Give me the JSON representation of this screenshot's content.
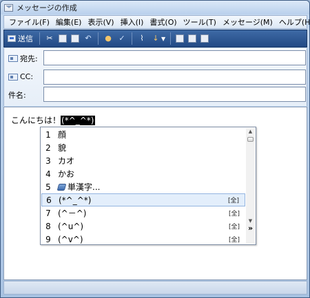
{
  "window": {
    "title": "メッセージの作成"
  },
  "menubar": {
    "items": [
      "ファイル(F)",
      "編集(E)",
      "表示(V)",
      "挿入(I)",
      "書式(O)",
      "ツール(T)",
      "メッセージ(M)",
      "ヘルプ(H)"
    ]
  },
  "toolbar": {
    "send_label": "送信",
    "icons": [
      "cut-icon",
      "copy-icon",
      "paste-icon",
      "undo-icon",
      "check-names-icon",
      "spelling-icon",
      "attach-icon",
      "priority-icon",
      "sign-icon",
      "encrypt-icon",
      "work-offline-icon"
    ]
  },
  "fields": {
    "to_label": "宛先:",
    "to_value": "",
    "cc_label": "CC:",
    "cc_value": "",
    "subject_label": "件名:",
    "subject_value": ""
  },
  "body": {
    "text": "こんにちは！",
    "selected_text": "(*^_^*)"
  },
  "ime": {
    "selected_index": 6,
    "candidates": [
      {
        "num": "1",
        "text": "顔",
        "tag": ""
      },
      {
        "num": "2",
        "text": "貌",
        "tag": ""
      },
      {
        "num": "3",
        "text": "カオ",
        "tag": ""
      },
      {
        "num": "4",
        "text": "かお",
        "tag": ""
      },
      {
        "num": "5",
        "text": "単漢字...",
        "tag": "",
        "icon": "dictionary-icon"
      },
      {
        "num": "6",
        "text": "(*^_^*)",
        "tag": "[全]"
      },
      {
        "num": "7",
        "text": "(^－^)",
        "tag": "[全]"
      },
      {
        "num": "8",
        "text": "(^u^)",
        "tag": "[全]"
      },
      {
        "num": "9",
        "text": "(^v^)",
        "tag": "[全]"
      }
    ],
    "expand_label": "»"
  }
}
